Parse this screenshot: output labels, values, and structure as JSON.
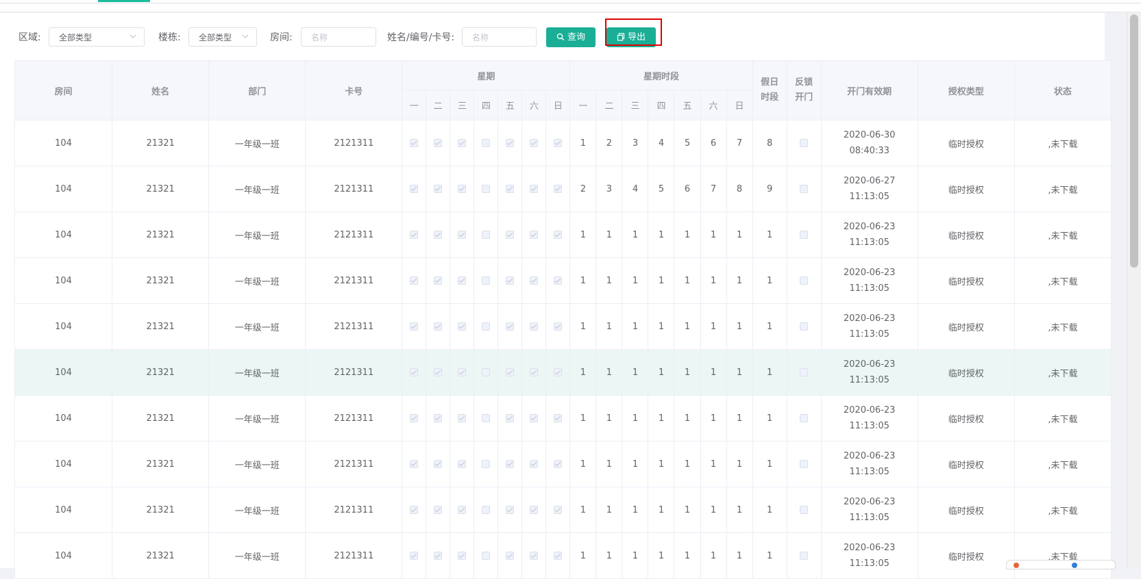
{
  "filters": {
    "area_label": "区域:",
    "area_value": "全部类型",
    "building_label": "楼栋:",
    "building_value": "全部类型",
    "room_label": "房间:",
    "room_placeholder": "名称",
    "person_label": "姓名/编号/卡号:",
    "person_placeholder": "名称",
    "query_button": "查询",
    "export_button": "导出"
  },
  "table": {
    "headers": {
      "room": "房间",
      "name": "姓名",
      "dept": "部门",
      "card": "卡号",
      "week": "星期",
      "week_period": "星期时段",
      "holiday": "假日时段",
      "antilock": "反锁开门",
      "expiry": "开门有效期",
      "auth_type": "授权类型",
      "status": "状态"
    },
    "day_labels": [
      "一",
      "二",
      "三",
      "四",
      "五",
      "六",
      "日"
    ],
    "rows": [
      {
        "room": "104",
        "name": "21321",
        "dept": "一年级一班",
        "card": "2121311",
        "week": [
          true,
          true,
          true,
          false,
          true,
          true,
          true
        ],
        "periods": [
          "1",
          "2",
          "3",
          "4",
          "5",
          "6",
          "7"
        ],
        "holiday": "8",
        "antilock": false,
        "expiry": "2020-06-30 08:40:33",
        "auth": "临时授权",
        "status": ",未下载"
      },
      {
        "room": "104",
        "name": "21321",
        "dept": "一年级一班",
        "card": "2121311",
        "week": [
          true,
          true,
          true,
          false,
          true,
          true,
          true
        ],
        "periods": [
          "2",
          "3",
          "4",
          "5",
          "6",
          "7",
          "8"
        ],
        "holiday": "9",
        "antilock": false,
        "expiry": "2020-06-27 11:13:05",
        "auth": "临时授权",
        "status": ",未下载"
      },
      {
        "room": "104",
        "name": "21321",
        "dept": "一年级一班",
        "card": "2121311",
        "week": [
          true,
          true,
          true,
          false,
          true,
          true,
          true
        ],
        "periods": [
          "1",
          "1",
          "1",
          "1",
          "1",
          "1",
          "1"
        ],
        "holiday": "1",
        "antilock": false,
        "expiry": "2020-06-23 11:13:05",
        "auth": "临时授权",
        "status": ",未下载"
      },
      {
        "room": "104",
        "name": "21321",
        "dept": "一年级一班",
        "card": "2121311",
        "week": [
          true,
          true,
          true,
          false,
          true,
          true,
          true
        ],
        "periods": [
          "1",
          "1",
          "1",
          "1",
          "1",
          "1",
          "1"
        ],
        "holiday": "1",
        "antilock": false,
        "expiry": "2020-06-23 11:13:05",
        "auth": "临时授权",
        "status": ",未下载"
      },
      {
        "room": "104",
        "name": "21321",
        "dept": "一年级一班",
        "card": "2121311",
        "week": [
          true,
          true,
          true,
          false,
          true,
          true,
          true
        ],
        "periods": [
          "1",
          "1",
          "1",
          "1",
          "1",
          "1",
          "1"
        ],
        "holiday": "1",
        "antilock": false,
        "expiry": "2020-06-23 11:13:05",
        "auth": "临时授权",
        "status": ",未下载"
      },
      {
        "room": "104",
        "name": "21321",
        "dept": "一年级一班",
        "card": "2121311",
        "week": [
          true,
          true,
          true,
          false,
          true,
          true,
          true
        ],
        "periods": [
          "1",
          "1",
          "1",
          "1",
          "1",
          "1",
          "1"
        ],
        "holiday": "1",
        "antilock": false,
        "expiry": "2020-06-23 11:13:05",
        "auth": "临时授权",
        "status": ",未下载",
        "hover": true
      },
      {
        "room": "104",
        "name": "21321",
        "dept": "一年级一班",
        "card": "2121311",
        "week": [
          true,
          true,
          true,
          false,
          true,
          true,
          true
        ],
        "periods": [
          "1",
          "1",
          "1",
          "1",
          "1",
          "1",
          "1"
        ],
        "holiday": "1",
        "antilock": false,
        "expiry": "2020-06-23 11:13:05",
        "auth": "临时授权",
        "status": ",未下载"
      },
      {
        "room": "104",
        "name": "21321",
        "dept": "一年级一班",
        "card": "2121311",
        "week": [
          true,
          true,
          true,
          false,
          true,
          true,
          true
        ],
        "periods": [
          "1",
          "1",
          "1",
          "1",
          "1",
          "1",
          "1"
        ],
        "holiday": "1",
        "antilock": false,
        "expiry": "2020-06-23 11:13:05",
        "auth": "临时授权",
        "status": ",未下载"
      },
      {
        "room": "104",
        "name": "21321",
        "dept": "一年级一班",
        "card": "2121311",
        "week": [
          true,
          true,
          true,
          false,
          true,
          true,
          true
        ],
        "periods": [
          "1",
          "1",
          "1",
          "1",
          "1",
          "1",
          "1"
        ],
        "holiday": "1",
        "antilock": false,
        "expiry": "2020-06-23 11:13:05",
        "auth": "临时授权",
        "status": ",未下载"
      },
      {
        "room": "104",
        "name": "21321",
        "dept": "一年级一班",
        "card": "2121311",
        "week": [
          true,
          true,
          true,
          false,
          true,
          true,
          true
        ],
        "periods": [
          "1",
          "1",
          "1",
          "1",
          "1",
          "1",
          "1"
        ],
        "holiday": "1",
        "antilock": false,
        "expiry": "2020-06-23 11:13:05",
        "auth": "临时授权",
        "status": ",未下载"
      }
    ]
  },
  "colors": {
    "accent": "#1aae96",
    "highlight": "#e00000",
    "header_bg": "#f5f7fa",
    "hover_row": "#ecf7f5"
  }
}
